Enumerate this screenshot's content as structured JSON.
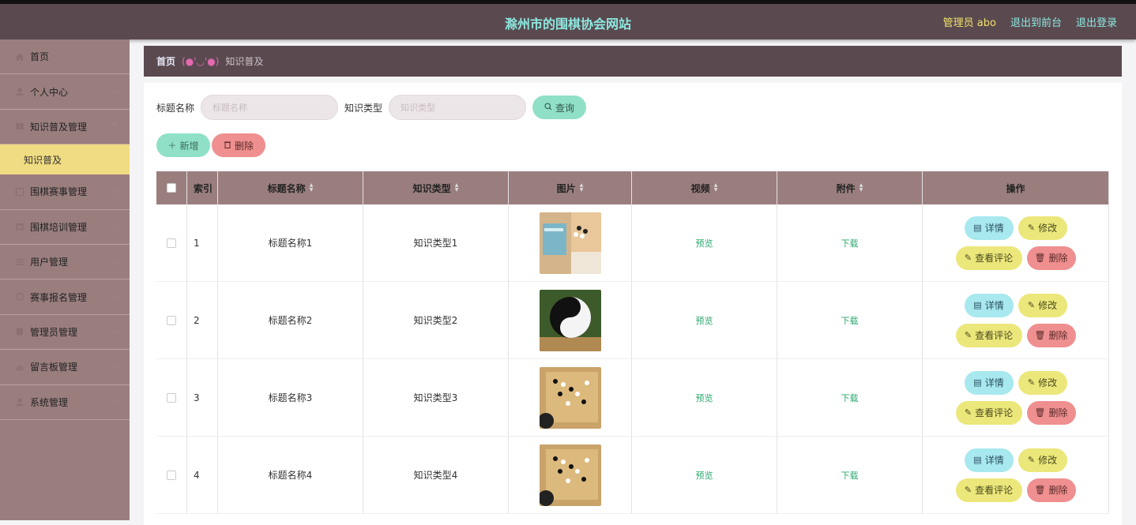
{
  "header": {
    "site_title": "滁州市的围棋协会网站",
    "admin_label": "管理员 abo",
    "to_front_label": "退出到前台",
    "logout_label": "退出登录"
  },
  "sidebar": {
    "items": [
      {
        "label": "首页",
        "icon": "home-icon"
      },
      {
        "label": "个人中心",
        "icon": "user-icon"
      },
      {
        "label": "知识普及管理",
        "icon": "book-icon"
      },
      {
        "label": "知识普及",
        "icon": "",
        "sub": true
      },
      {
        "label": "围棋赛事管理",
        "icon": "trophy-icon"
      },
      {
        "label": "围棋培训管理",
        "icon": "calendar-icon"
      },
      {
        "label": "用户管理",
        "icon": "list-icon"
      },
      {
        "label": "赛事报名管理",
        "icon": "form-icon"
      },
      {
        "label": "管理员管理",
        "icon": "admin-icon"
      },
      {
        "label": "留言板管理",
        "icon": "chart-icon"
      },
      {
        "label": "系统管理",
        "icon": "settings-icon"
      }
    ]
  },
  "breadcrumb": {
    "home": "首页",
    "face": "(●'◡'●)",
    "current": "知识普及"
  },
  "search": {
    "title_label": "标题名称",
    "title_placeholder": "标题名称",
    "type_label": "知识类型",
    "type_placeholder": "知识类型",
    "query_label": "查询"
  },
  "actions": {
    "add_label": "新增",
    "delete_label": "删除"
  },
  "table": {
    "columns": [
      "索引",
      "标题名称",
      "知识类型",
      "图片",
      "视频",
      "附件",
      "操作"
    ],
    "rows": [
      {
        "index": "1",
        "title": "标题名称1",
        "type": "知识类型1",
        "video": "预览",
        "attachment": "下载"
      },
      {
        "index": "2",
        "title": "标题名称2",
        "type": "知识类型2",
        "video": "预览",
        "attachment": "下载"
      },
      {
        "index": "3",
        "title": "标题名称3",
        "type": "知识类型3",
        "video": "预览",
        "attachment": "下载"
      },
      {
        "index": "4",
        "title": "标题名称4",
        "type": "知识类型4",
        "video": "预览",
        "attachment": "下载"
      }
    ],
    "op_labels": {
      "detail": "详情",
      "edit": "修改",
      "comment": "查看评论",
      "remove": "删除"
    }
  },
  "colors": {
    "topbar": "#5a4a50",
    "sidebar": "#9a7e7e",
    "accent_title": "#8ee8e0",
    "active_menu": "#f0dc82"
  }
}
